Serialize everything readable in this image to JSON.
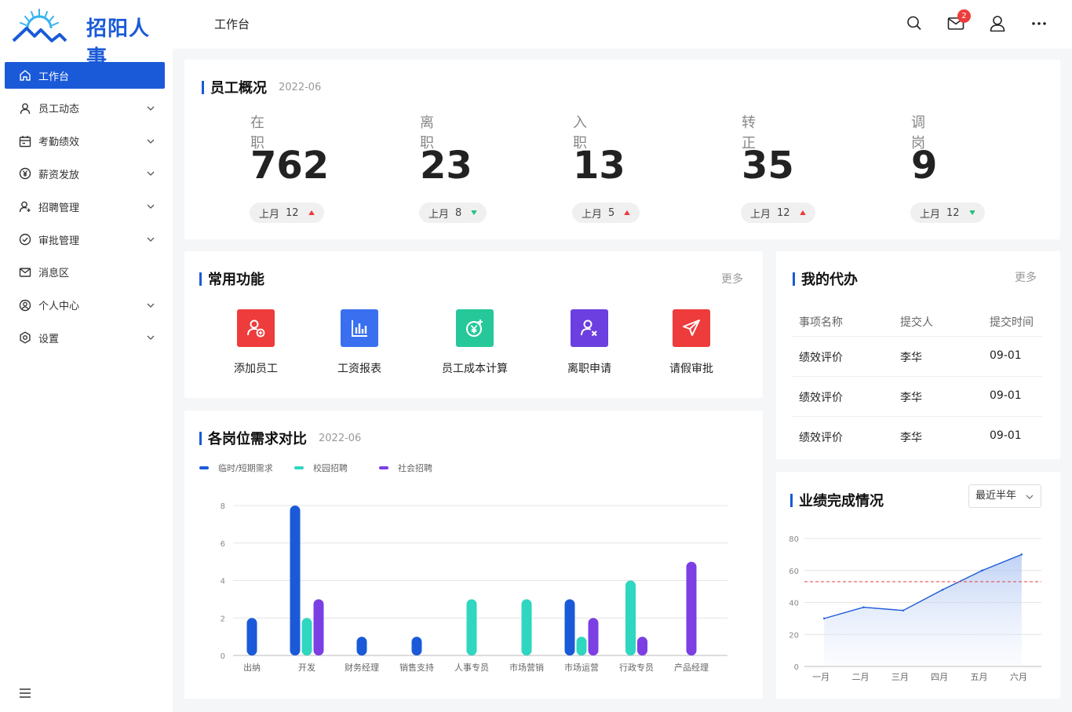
{
  "brand": {
    "name": "招阳人事"
  },
  "sidebar": {
    "items": [
      {
        "label": "工作台",
        "icon": "home-icon",
        "active": true,
        "expandable": false
      },
      {
        "label": "员工动态",
        "icon": "user-icon",
        "active": false,
        "expandable": true
      },
      {
        "label": "考勤绩效",
        "icon": "calendar-icon",
        "active": false,
        "expandable": true
      },
      {
        "label": "薪资发放",
        "icon": "yen-icon",
        "active": false,
        "expandable": true
      },
      {
        "label": "招聘管理",
        "icon": "user-add-icon",
        "active": false,
        "expandable": true
      },
      {
        "label": "审批管理",
        "icon": "check-circle-icon",
        "active": false,
        "expandable": true
      },
      {
        "label": "消息区",
        "icon": "mail-icon",
        "active": false,
        "expandable": false
      },
      {
        "label": "个人中心",
        "icon": "profile-icon",
        "active": false,
        "expandable": true
      },
      {
        "label": "设置",
        "icon": "settings-icon",
        "active": false,
        "expandable": true
      }
    ]
  },
  "header": {
    "title": "工作台",
    "mail_badge": "2"
  },
  "overview": {
    "title": "员工概况",
    "date": "2022-06",
    "stats": [
      {
        "label": "在职",
        "value": "762",
        "prev_label": "上月",
        "prev_value": "12",
        "trend": "up"
      },
      {
        "label": "离职",
        "value": "23",
        "prev_label": "上月",
        "prev_value": "8",
        "trend": "down"
      },
      {
        "label": "入职",
        "value": "13",
        "prev_label": "上月",
        "prev_value": "5",
        "trend": "up"
      },
      {
        "label": "转正",
        "value": "35",
        "prev_label": "上月",
        "prev_value": "12",
        "trend": "up"
      },
      {
        "label": "调岗",
        "value": "9",
        "prev_label": "上月",
        "prev_value": "12",
        "trend": "down"
      }
    ]
  },
  "quick": {
    "title": "常用功能",
    "more": "更多",
    "items": [
      {
        "label": "添加员工",
        "icon": "add-user-icon",
        "color": "#ee3b3b"
      },
      {
        "label": "工资报表",
        "icon": "bar-report-icon",
        "color": "#3a6ff0"
      },
      {
        "label": "员工成本计算",
        "icon": "cost-calc-icon",
        "color": "#26c89a"
      },
      {
        "label": "离职申请",
        "icon": "resign-icon",
        "color": "#6c3fe0"
      },
      {
        "label": "请假审批",
        "icon": "send-icon",
        "color": "#ee3b3b"
      }
    ]
  },
  "todo": {
    "title": "我的代办",
    "more": "更多",
    "columns": [
      "事项名称",
      "提交人",
      "提交时间"
    ],
    "rows": [
      [
        "绩效评价",
        "李华",
        "09-01"
      ],
      [
        "绩效评价",
        "李华",
        "09-01"
      ],
      [
        "绩效评价",
        "李华",
        "09-01"
      ]
    ]
  },
  "demand": {
    "title": "各岗位需求对比",
    "date": "2022-06"
  },
  "performance": {
    "title": "业绩完成情况",
    "range": "最近半年"
  },
  "chart_data": [
    {
      "type": "bar",
      "categories": [
        "出纳",
        "开发",
        "财务经理",
        "销售支持",
        "人事专员",
        "市场营销",
        "市场运营",
        "行政专员",
        "产品经理"
      ],
      "series": [
        {
          "name": "临时/短期需求",
          "color": "#1a5ad8",
          "values": [
            2,
            8,
            1,
            1,
            0,
            0,
            3,
            0,
            0
          ]
        },
        {
          "name": "校园招聘",
          "color": "#2fd6c0",
          "values": [
            0,
            2,
            0,
            0,
            3,
            3,
            1,
            4,
            0
          ]
        },
        {
          "name": "社会招聘",
          "color": "#7b3fe4",
          "values": [
            0,
            3,
            0,
            0,
            0,
            0,
            2,
            1,
            5
          ]
        }
      ],
      "ylim": [
        0,
        8
      ],
      "yticks": [
        0,
        2,
        4,
        6,
        8
      ],
      "grid": true,
      "legend": "top-left"
    },
    {
      "type": "area",
      "categories": [
        "一月",
        "二月",
        "三月",
        "四月",
        "五月",
        "六月"
      ],
      "values": [
        30,
        37,
        35,
        48,
        60,
        70
      ],
      "target": 53,
      "ylim": [
        0,
        80
      ],
      "yticks": [
        0,
        20,
        40,
        60,
        80
      ],
      "color": "#1a5ad8",
      "target_color": "#ee3b3b"
    }
  ]
}
